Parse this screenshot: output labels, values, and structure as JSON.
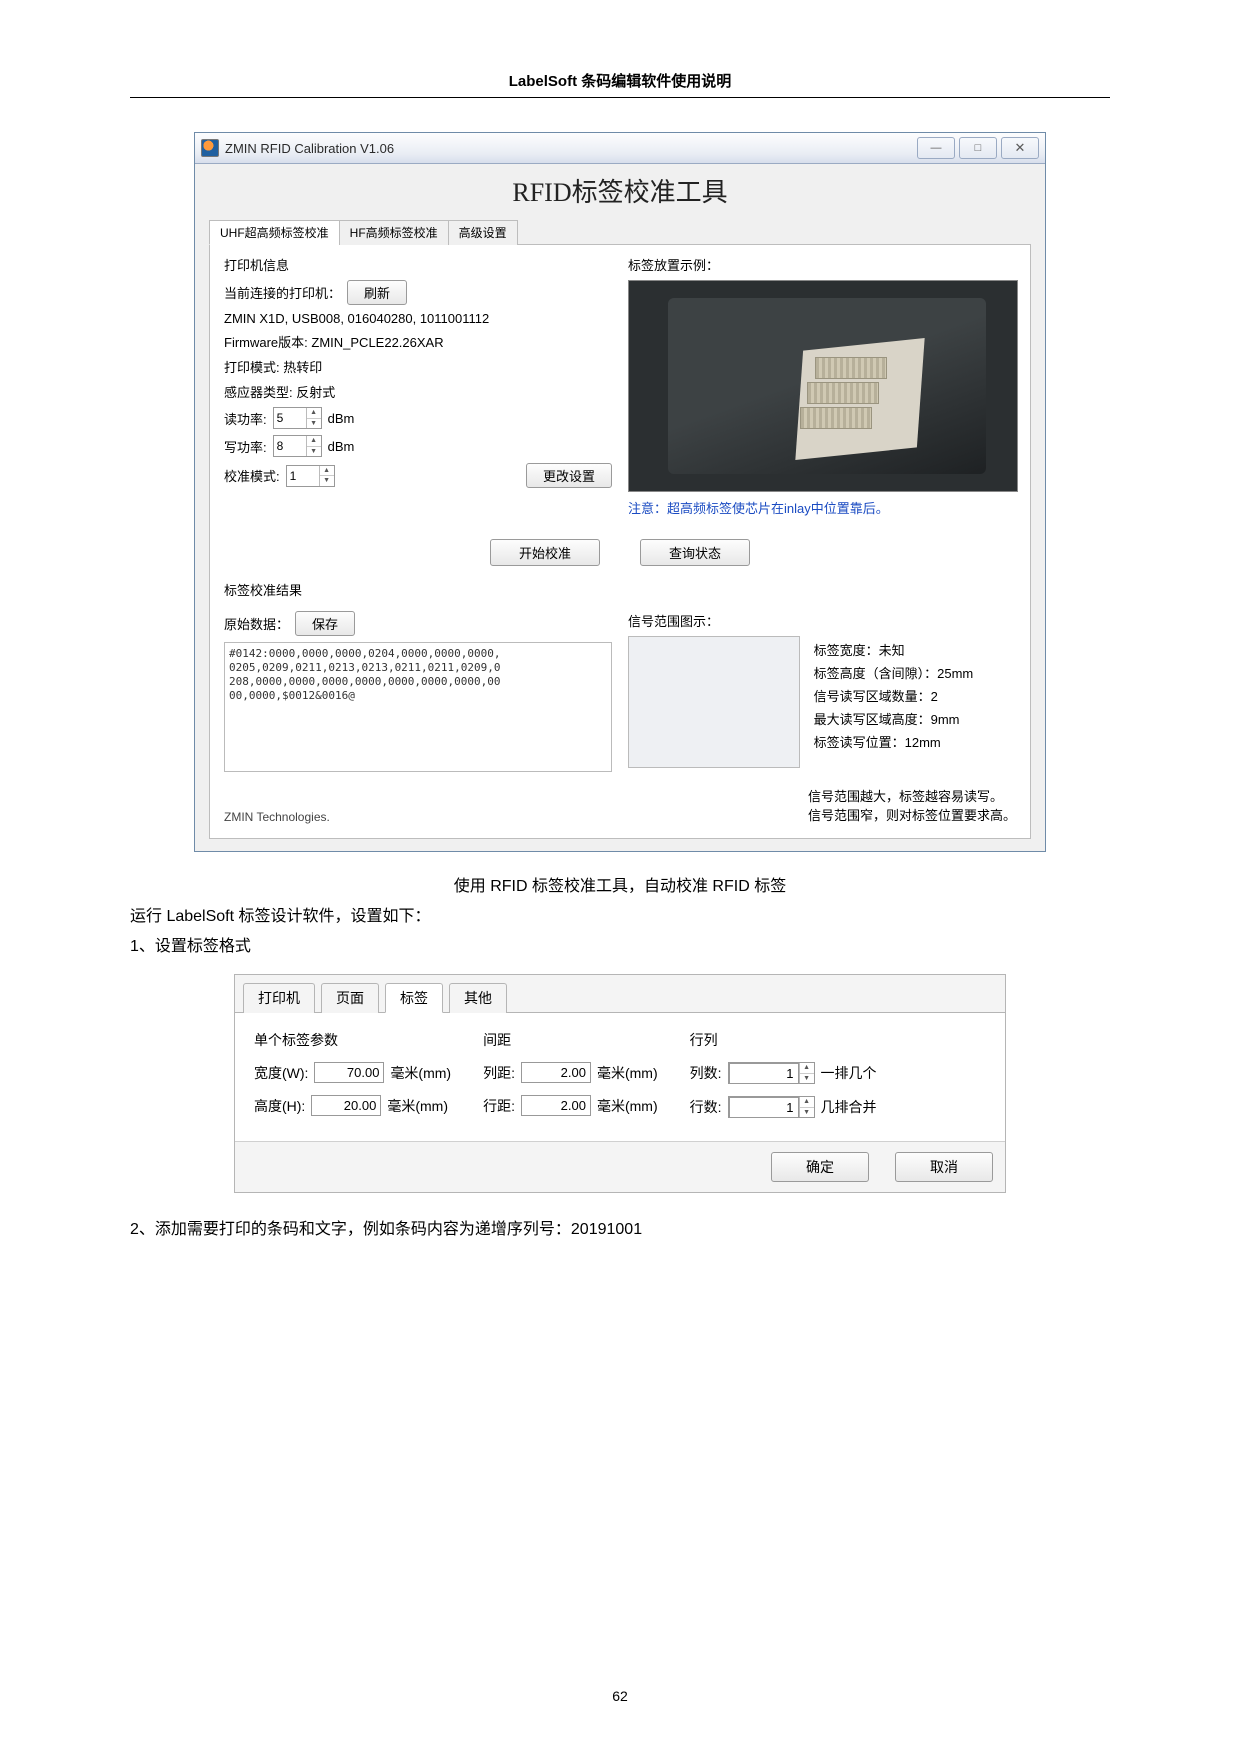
{
  "doc": {
    "header": "LabelSoft 条码编辑软件使用说明",
    "page_number": "62",
    "caption": "使用 RFID 标签校准工具，自动校准 RFID 标签",
    "para1": "运行 LabelSoft 标签设计软件，设置如下：",
    "step1": "1、设置标签格式",
    "step2": "2、添加需要打印的条码和文字，例如条码内容为递增序列号：20191001"
  },
  "win1": {
    "title": "ZMIN RFID Calibration V1.06",
    "hero": "RFID标签校准工具",
    "tabs": {
      "t1": "UHF超高频标签校准",
      "t2": "HF高频标签校准",
      "t3": "高级设置"
    },
    "printer_info_title": "打印机信息",
    "connected_label": "当前连接的打印机：",
    "refresh": "刷新",
    "printer_line": "ZMIN X1D, USB008, 016040280, 1011001112",
    "firmware_line": "Firmware版本: ZMIN_PCLE22.26XAR",
    "mode_line": "打印模式: 热转印",
    "sensor_line": "感应器类型: 反射式",
    "read_label": "读功率:",
    "read_val": "5",
    "write_label": "写功率:",
    "write_val": "8",
    "dbm": "dBm",
    "cal_mode_label": "校准模式:",
    "cal_mode_val": "1",
    "change_btn": "更改设置",
    "example_title": "标签放置示例：",
    "example_note": "注意：超高频标签使芯片在inlay中位置靠后。",
    "start_btn": "开始校准",
    "query_btn": "查询状态",
    "result_title": "标签校准结果",
    "raw_label": "原始数据：",
    "save_btn": "保存",
    "raw_text": "#0142:0000,0000,0000,0204,0000,0000,0000,\n0205,0209,0211,0213,0213,0211,0211,0209,0\n208,0000,0000,0000,0000,0000,0000,0000,00\n00,0000,$0012&0016@",
    "sig_title": "信号范围图示：",
    "stats": {
      "width": "标签宽度：未知",
      "height": "标签高度（含间隙）：25mm",
      "regions": "信号读写区域数量：2",
      "max_h": "最大读写区域高度：9mm",
      "pos": "标签读写位置：12mm"
    },
    "sig_note1": "信号范围越大，标签越容易读写。",
    "sig_note2": "信号范围窄，则对标签位置要求高。",
    "brand": "ZMIN Technologies."
  },
  "win2": {
    "tabs": {
      "t1": "打印机",
      "t2": "页面",
      "t3": "标签",
      "t4": "其他"
    },
    "g1_title": "单个标签参数",
    "width_label": "宽度(W):",
    "width_val": "70.00",
    "height_label": "高度(H):",
    "height_val": "20.00",
    "unit_mm": "毫米(mm)",
    "g2_title": "间距",
    "col_gap_label": "列距:",
    "col_gap_val": "2.00",
    "row_gap_label": "行距:",
    "row_gap_val": "2.00",
    "g3_title": "行列",
    "cols_label": "列数:",
    "cols_val": "1",
    "cols_suffix": "一排几个",
    "rows_label": "行数:",
    "rows_val": "1",
    "rows_suffix": "几排合并",
    "ok": "确定",
    "cancel": "取消"
  }
}
